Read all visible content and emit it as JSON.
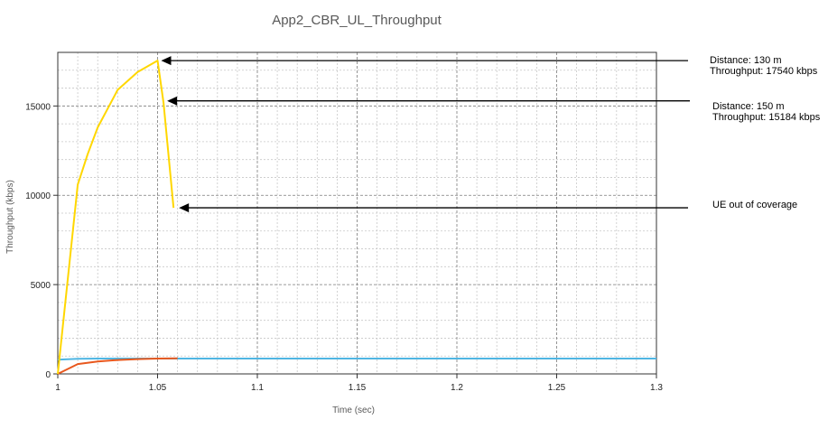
{
  "chart_data": {
    "type": "line",
    "title": "App2_CBR_UL_Throughput",
    "xlabel": "Time (sec)",
    "ylabel": "Throughput (kbps)",
    "xlim": [
      1.0,
      1.3
    ],
    "ylim": [
      0,
      18000
    ],
    "x_ticks": [
      "1",
      "1.05",
      "1.1",
      "1.15",
      "1.2",
      "1.25",
      "1.3"
    ],
    "x_tick_values": [
      1.0,
      1.05,
      1.1,
      1.15,
      1.2,
      1.25,
      1.3
    ],
    "y_ticks": [
      "0",
      "5000",
      "10000",
      "15000"
    ],
    "y_tick_values": [
      0,
      5000,
      10000,
      15000
    ],
    "grid": true,
    "series": [
      {
        "color": "#ffd700",
        "x": [
          1.0,
          1.01,
          1.015,
          1.02,
          1.03,
          1.04,
          1.05,
          1.053,
          1.058
        ],
        "y": [
          0,
          10600,
          12300,
          13800,
          15900,
          16900,
          17540,
          15184,
          9300
        ]
      },
      {
        "color": "#e8581e",
        "x": [
          1.0,
          1.01,
          1.02,
          1.03,
          1.04,
          1.05,
          1.06
        ],
        "y": [
          0,
          550,
          700,
          780,
          830,
          860,
          870
        ]
      },
      {
        "color": "#4fb6e3",
        "x": [
          1.0,
          1.01,
          1.02,
          1.05,
          1.1,
          1.2,
          1.3
        ],
        "y": [
          800,
          850,
          860,
          860,
          860,
          860,
          860
        ]
      }
    ],
    "annotations": [
      {
        "lines": [
          "Distance: 130 m",
          "Throughput: 17540 kbps"
        ],
        "x": 1.05,
        "y": 17540
      },
      {
        "lines": [
          "Distance: 150 m",
          "Throughput: 15184 kbps"
        ],
        "x": 1.053,
        "y": 15184
      },
      {
        "lines": [
          "UE out of coverage"
        ],
        "x": 1.058,
        "y": 9300
      }
    ]
  }
}
